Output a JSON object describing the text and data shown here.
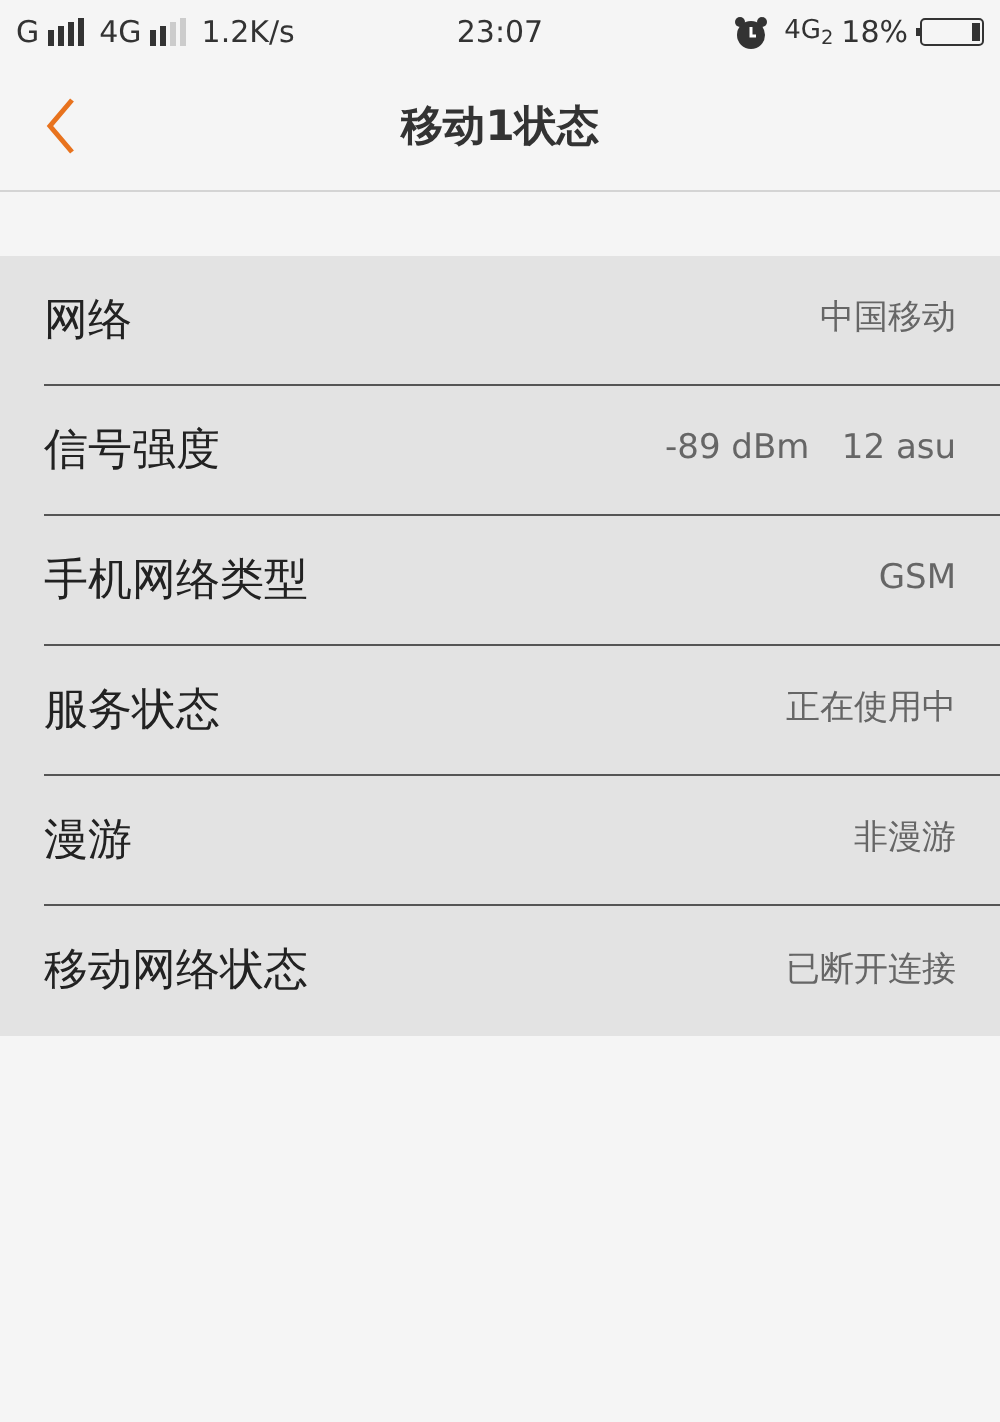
{
  "status_bar": {
    "sim1": "G",
    "sim2": "4G",
    "speed": "1.2K/s",
    "time": "23:07",
    "network": "4G$_{2}$",
    "battery": "18%"
  },
  "header": {
    "title": "移动1状态"
  },
  "rows": [
    {
      "label": "网络",
      "value": "中国移动"
    },
    {
      "label": "信号强度",
      "value": "-89 dBm   12 asu"
    },
    {
      "label": "手机网络类型",
      "value": "GSM"
    },
    {
      "label": "服务状态",
      "value": "正在使用中"
    },
    {
      "label": "漫游",
      "value": "非漫游"
    },
    {
      "label": "移动网络状态",
      "value": "已断开连接"
    }
  ]
}
